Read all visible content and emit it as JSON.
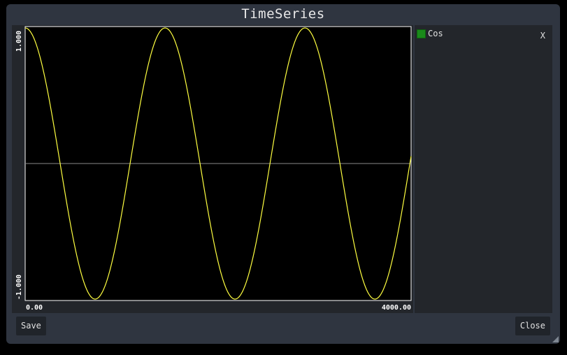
{
  "window": {
    "title": "TimeSeries"
  },
  "legend": {
    "items": [
      {
        "label": "Cos",
        "color": "#1a8a1a"
      }
    ],
    "close_label": "X"
  },
  "buttons": {
    "save_label": "Save",
    "close_label": "Close"
  },
  "chart_data": {
    "type": "line",
    "x_tick_labels": [
      "0.00",
      "4000.00"
    ],
    "y_tick_labels": [
      "1.000",
      "-1.000"
    ],
    "xlim": [
      0,
      4000
    ],
    "ylim": [
      -1,
      1
    ],
    "series": [
      {
        "name": "Cos",
        "color": "#ffff40",
        "function": "cos",
        "period": 1450,
        "amplitude": 1,
        "x_start": 0,
        "x_end": 4000
      }
    ],
    "zero_line": true,
    "grid": false,
    "background": "#000000"
  }
}
